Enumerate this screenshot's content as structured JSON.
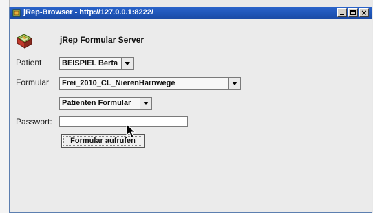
{
  "window": {
    "title": "jRep-Browser - http://127.0.0.1:8222/",
    "buttons": {
      "minimize": "minimize",
      "maximize": "maximize",
      "close": "×"
    }
  },
  "header": {
    "app_title": "jRep Formular Server",
    "app_icon": "book-icon"
  },
  "form": {
    "patient_label": "Patient",
    "patient_value": "BEISPIEL Berta",
    "formular_label": "Formular",
    "formular_value": "Frei_2010_CL_NierenHarnwege",
    "type_value": "Patienten Formular",
    "password_label": "Passwort:",
    "password_value": "",
    "submit_label": "Formular aufrufen"
  },
  "colors": {
    "titlebar": "#1f55b8",
    "window_bg": "#ebebeb",
    "field_border": "#7a7a7a"
  },
  "icons": [
    "book-icon",
    "chevron-down-icon",
    "mouse-cursor-icon"
  ]
}
